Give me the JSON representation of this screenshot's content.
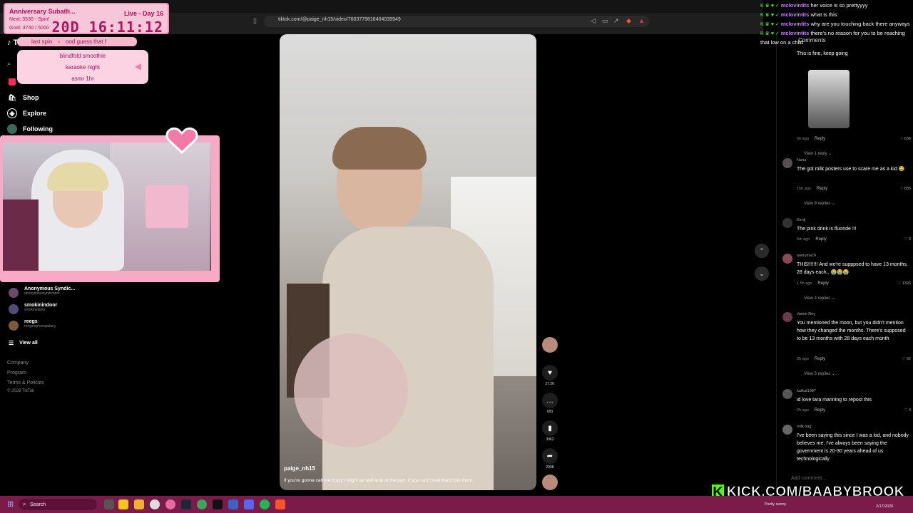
{
  "browser": {
    "url": "tiktok.com/@paige_nh15/video/7603779818404039949"
  },
  "subathon": {
    "title": "Anniversary Subath...",
    "live_day": "Live - Day 16",
    "next": "Next: 3530 - Spin!",
    "goal": "Goal: 3740 / 5000",
    "timer": "20D 16:11:12"
  },
  "spin": {
    "last_label": "last spin",
    "current": "ood guess that f",
    "options": [
      "blindfold smoothie",
      "karaoke night",
      "asmr 1hr"
    ]
  },
  "sidebar": {
    "logo": "TikTok",
    "nav": [
      {
        "label": "Shop",
        "icon": "shop-icon"
      },
      {
        "label": "Explore",
        "icon": "explore-icon"
      },
      {
        "label": "Following",
        "icon": "following-icon"
      }
    ],
    "accounts": [
      {
        "name": "Anonymous Syndic...",
        "handle": "anonymoussyndicatee"
      },
      {
        "name": "smokinindoor",
        "handle": "smokinindoor"
      },
      {
        "name": "reegs",
        "handle": "reegsngreengadany"
      }
    ],
    "view_all": "View all",
    "footer": [
      "Company",
      "Program",
      "Terms & Policies",
      "© 2026 TikTok"
    ]
  },
  "video": {
    "author": "paige_nh15",
    "caption": "If you're gonna call me crazy I might as well look at the part. If you can't beat them join them.",
    "likes": "27.2K",
    "comments": "693",
    "saves": "3962",
    "shares": "2998"
  },
  "comments_panel": {
    "header": "Comments",
    "items": [
      {
        "user": "",
        "text": "This is fine, keep going",
        "time": "6h ago",
        "reply": "Reply",
        "likes": "638",
        "view": "View 1 reply"
      },
      {
        "user": "Nana",
        "text": "The got milk posters use to scare me as a kid 😂",
        "time": "15h ago",
        "reply": "Reply",
        "likes": "835",
        "view": "View 9 replies"
      },
      {
        "user": "Kenji",
        "text": "The pink drink is fluoride !!!",
        "time": "5m ago",
        "reply": "Reply",
        "likes": "0",
        "view": ""
      },
      {
        "user": "auntymac0",
        "text": "THIS!!!!!!! And we're supppsed to have 13 months, 28 days each.. 😭😭😭",
        "time": "1.5h ago",
        "reply": "Reply",
        "likes": "1393",
        "view": "View 4 replies"
      },
      {
        "user": "Jamie Rey",
        "text": "You mentioned the moon, but you didn't mention how they changed the months. There's supposed to be 13 months with 28 days each month",
        "time": "3h ago",
        "reply": "Reply",
        "likes": "62",
        "view": "View 5 replies"
      },
      {
        "user": "katkat1987",
        "text": "id love tara manning to repost this",
        "time": "2h ago",
        "reply": "Reply",
        "likes": "4",
        "view": ""
      },
      {
        "user": "milk bag",
        "text": "I've been saying this since I was a kid, and nobody believes me. I've always been saying the government is 20-30 years ahead of us technologically",
        "time": "",
        "reply": "",
        "likes": "",
        "view": ""
      }
    ],
    "add_comment_placeholder": "Add comment..."
  },
  "chat": [
    {
      "user": "mclovintits",
      "text": "her voice is so prettyyyy"
    },
    {
      "user": "mclovintits",
      "text": "what is this"
    },
    {
      "user": "mclovintits",
      "text": "why are you touching back there anyways"
    },
    {
      "user": "mclovintits",
      "text": "there's no reason for you to be reaching that low on a child"
    }
  ],
  "kick": {
    "logo": "K",
    "text": "KICK.COM/BAABYBROOK"
  },
  "taskbar": {
    "search": "Search",
    "weather": "Partly sunny",
    "date": "2/17/2026"
  }
}
